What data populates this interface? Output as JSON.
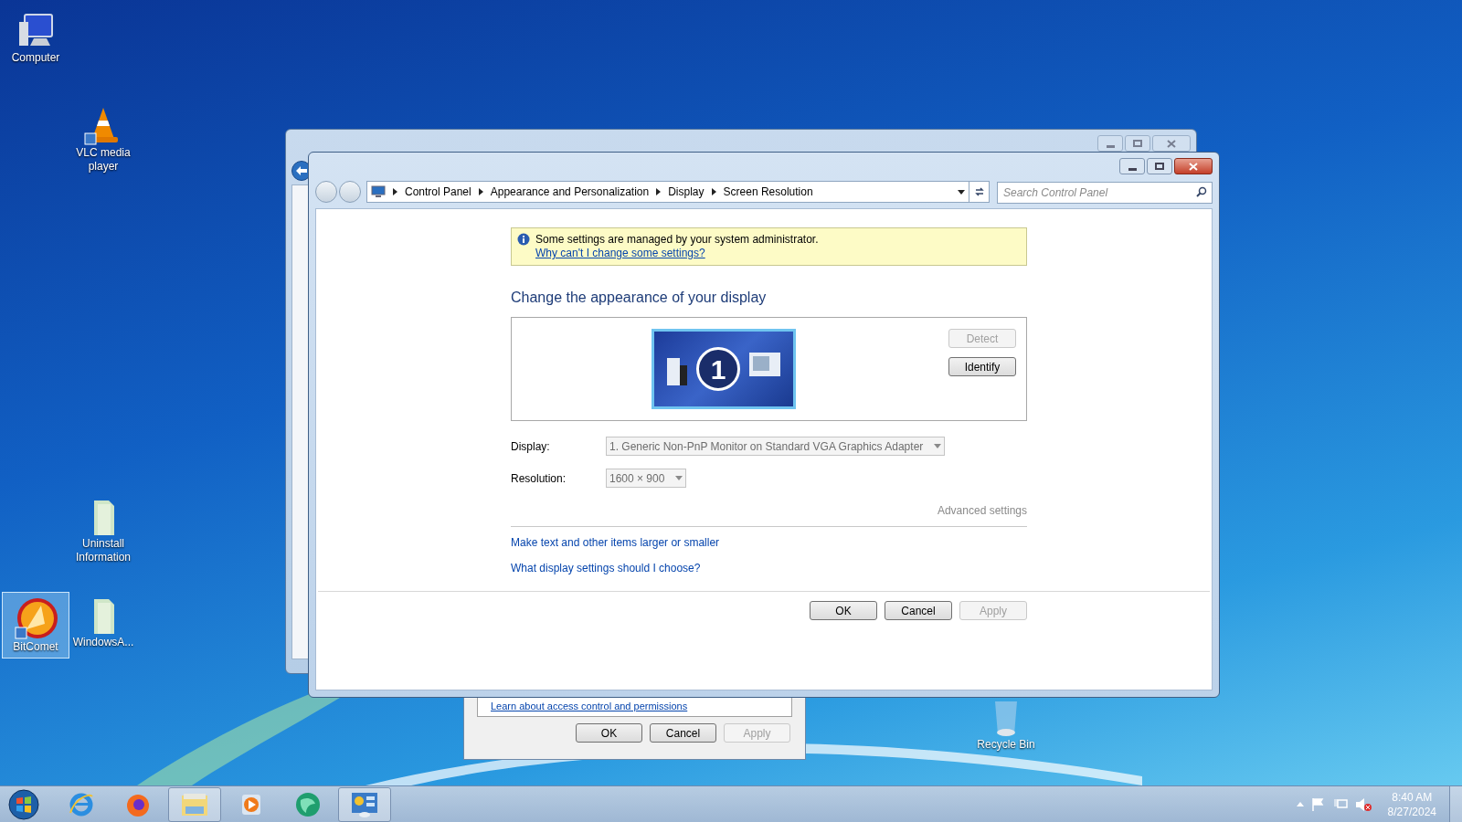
{
  "desktop_icons": [
    {
      "label": "Computer",
      "kind": "computer",
      "selected": false
    },
    {
      "label": "VLC media player",
      "kind": "vlc",
      "selected": false
    },
    {
      "label": "Uninstall Information",
      "kind": "folder",
      "selected": false
    },
    {
      "label": "BitComet",
      "kind": "bitcomet",
      "selected": true
    },
    {
      "label": "WindowsA...",
      "kind": "folder",
      "selected": false
    },
    {
      "label": "Recycle Bin",
      "kind": "recycle",
      "selected": false
    }
  ],
  "background_dialog": {
    "link": "Learn about access control and permissions",
    "buttons": [
      {
        "label": "OK",
        "disabled": false
      },
      {
        "label": "Cancel",
        "disabled": false
      },
      {
        "label": "Apply",
        "disabled": true
      }
    ]
  },
  "window": {
    "breadcrumbs": [
      "Control Panel",
      "Appearance and Personalization",
      "Display",
      "Screen Resolution"
    ],
    "search": {
      "placeholder": "Search Control Panel"
    },
    "notice": {
      "text": "Some settings are managed by your system administrator.",
      "link": "Why can't I change some settings?"
    },
    "heading": "Change the appearance of your display",
    "monitor": {
      "number": "1",
      "selected": true
    },
    "side_buttons": [
      {
        "label": "Detect",
        "disabled": true
      },
      {
        "label": "Identify",
        "disabled": false
      }
    ],
    "fields": [
      {
        "label": "Display:",
        "value": "1. Generic Non-PnP Monitor on Standard VGA Graphics Adapter",
        "disabled": true
      },
      {
        "label": "Resolution:",
        "value": "1600 × 900",
        "disabled": true
      }
    ],
    "advanced_link": {
      "label": "Advanced settings",
      "disabled": true
    },
    "links": [
      "Make text and other items larger or smaller",
      "What display settings should I choose?"
    ],
    "buttons": [
      {
        "label": "OK",
        "disabled": false
      },
      {
        "label": "Cancel",
        "disabled": false
      },
      {
        "label": "Apply",
        "disabled": true
      }
    ]
  },
  "taskbar": {
    "apps": [
      {
        "kind": "ie",
        "running": false
      },
      {
        "kind": "firefox",
        "running": false
      },
      {
        "kind": "explorer",
        "running": true
      },
      {
        "kind": "mediaplayer",
        "running": false
      },
      {
        "kind": "globe",
        "running": false
      },
      {
        "kind": "controlpanel",
        "running": true
      }
    ],
    "clock": {
      "time": "8:40 AM",
      "date": "8/27/2024"
    }
  }
}
